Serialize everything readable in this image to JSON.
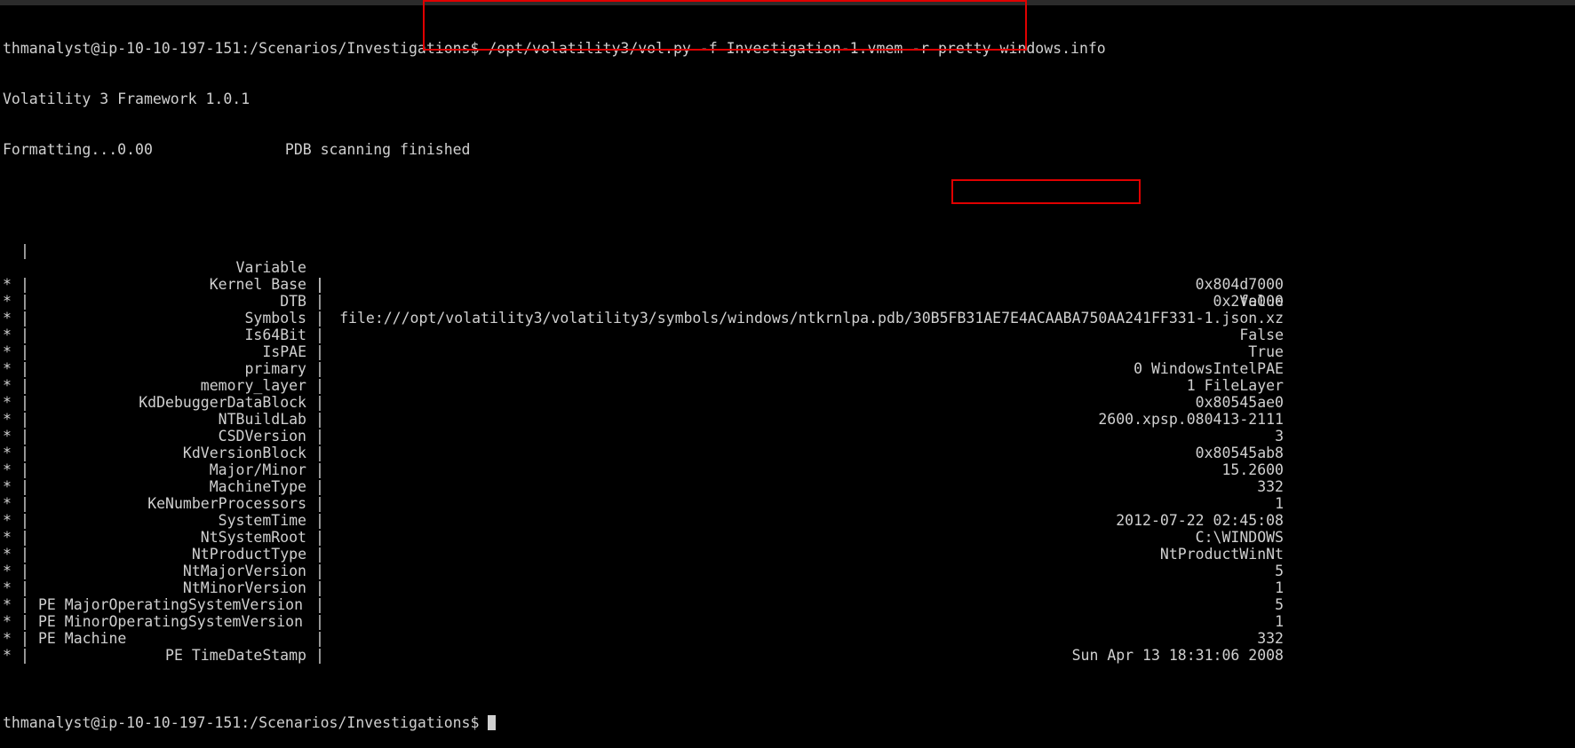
{
  "prompt": "thmanalyst@ip-10-10-197-151:/Scenarios/Investigations$",
  "command": " /opt/volatility3/vol.py -f Investigation-1.vmem -r pretty windows.info",
  "framework": "Volatility 3 Framework 1.0.1",
  "progress": "Formatting...0.00               PDB scanning finished",
  "header": {
    "star": " ",
    "pipe": "|",
    "variable": "Variable",
    "value": "Value"
  },
  "rows": [
    {
      "star": "*",
      "variable": "Kernel Base",
      "value": "0x804d7000"
    },
    {
      "star": "*",
      "variable": "DTB",
      "value": "0x2fe000"
    },
    {
      "star": "*",
      "variable": "Symbols",
      "value": "file:///opt/volatility3/volatility3/symbols/windows/ntkrnlpa.pdb/30B5FB31AE7E4ACAABA750AA241FF331-1.json.xz"
    },
    {
      "star": "*",
      "variable": "Is64Bit",
      "value": "False"
    },
    {
      "star": "*",
      "variable": "IsPAE",
      "value": "True"
    },
    {
      "star": "*",
      "variable": "primary",
      "value": "0 WindowsIntelPAE"
    },
    {
      "star": "*",
      "variable": "memory_layer",
      "value": "1 FileLayer"
    },
    {
      "star": "*",
      "variable": "KdDebuggerDataBlock",
      "value": "0x80545ae0"
    },
    {
      "star": "*",
      "variable": "NTBuildLab",
      "value": "2600.xpsp.080413-2111"
    },
    {
      "star": "*",
      "variable": "CSDVersion",
      "value": "3"
    },
    {
      "star": "*",
      "variable": "KdVersionBlock",
      "value": "0x80545ab8"
    },
    {
      "star": "*",
      "variable": "Major/Minor",
      "value": "15.2600"
    },
    {
      "star": "*",
      "variable": "MachineType",
      "value": "332"
    },
    {
      "star": "*",
      "variable": "KeNumberProcessors",
      "value": "1"
    },
    {
      "star": "*",
      "variable": "SystemTime",
      "value": "2012-07-22 02:45:08"
    },
    {
      "star": "*",
      "variable": "NtSystemRoot",
      "value": "C:\\WINDOWS"
    },
    {
      "star": "*",
      "variable": "NtProductType",
      "value": "NtProductWinNt"
    },
    {
      "star": "*",
      "variable": "NtMajorVersion",
      "value": "5"
    },
    {
      "star": "*",
      "variable": "NtMinorVersion",
      "value": "1"
    },
    {
      "star": "*",
      "variable": "PE MajorOperatingSystemVersion",
      "value": "5"
    },
    {
      "star": "*",
      "variable": "PE MinorOperatingSystemVersion",
      "value": "1"
    },
    {
      "star": "*",
      "variable": "PE Machine",
      "value": "332"
    },
    {
      "star": "*",
      "variable": "PE TimeDateStamp",
      "value": "Sun Apr 13 18:31:06 2008"
    }
  ],
  "final_prompt": "thmanalyst@ip-10-10-197-151:/Scenarios/Investigations$",
  "colors": {
    "background": "#000000",
    "text": "#d0d0d0",
    "highlight_box": "#e00000"
  }
}
